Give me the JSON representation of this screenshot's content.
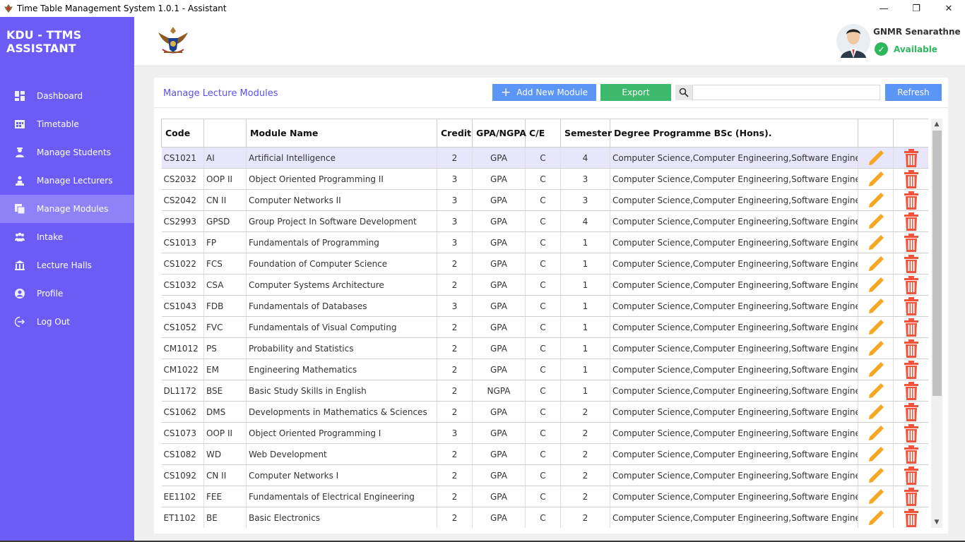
{
  "window": {
    "title": "Time Table Management System 1.0.1 - Assistant",
    "minimize": "—",
    "maximize": "❐",
    "close": "✕"
  },
  "brand": "KDU - TTMS ASSISTANT",
  "sidebar": {
    "items": [
      {
        "label": "Dashboard",
        "icon": "dashboard-icon"
      },
      {
        "label": "Timetable",
        "icon": "timetable-icon"
      },
      {
        "label": "Manage Students",
        "icon": "student-icon"
      },
      {
        "label": "Manage Lecturers",
        "icon": "lecturer-icon"
      },
      {
        "label": "Manage Modules",
        "icon": "modules-icon",
        "active": true
      },
      {
        "label": "Intake",
        "icon": "intake-icon"
      },
      {
        "label": "Lecture Halls",
        "icon": "building-icon"
      },
      {
        "label": "Profile",
        "icon": "profile-icon"
      },
      {
        "label": "Log Out",
        "icon": "logout-icon"
      }
    ]
  },
  "user": {
    "name": "GNMR Senarathne",
    "status": "Available"
  },
  "panel": {
    "title": "Manage Lecture Modules",
    "add_label": "Add New Module",
    "export_label": "Export",
    "refresh_label": "Refresh",
    "search_value": ""
  },
  "table": {
    "headers": [
      "Code",
      "",
      "Module Name",
      "Credit",
      "GPA/NGPA",
      "C/E",
      "Semester",
      "Degree Programme BSc (Hons).",
      "",
      ""
    ],
    "rows": [
      [
        "CS1021",
        "AI",
        "Artificial Intelligence",
        "2",
        "GPA",
        "C",
        "4",
        "Computer Science,Computer Engineering,Software Engineering"
      ],
      [
        "CS2032",
        "OOP II",
        "Object Oriented Programming II",
        "3",
        "GPA",
        "C",
        "3",
        "Computer Science,Computer Engineering,Software Engineering"
      ],
      [
        "CS2042",
        "CN II",
        "Computer Networks II",
        "3",
        "GPA",
        "C",
        "3",
        "Computer Science,Computer Engineering,Software Engineering"
      ],
      [
        "CS2993",
        "GPSD",
        "Group Project In Software Development",
        "3",
        "GPA",
        "C",
        "4",
        "Computer Science,Computer Engineering,Software Engineering"
      ],
      [
        "CS1013",
        "FP",
        "Fundamentals of Programming",
        "3",
        "GPA",
        "C",
        "1",
        "Computer Science,Computer Engineering,Software Engineering"
      ],
      [
        "CS1022",
        "FCS",
        "Foundation of Computer Science",
        "2",
        "GPA",
        "C",
        "1",
        "Computer Science,Computer Engineering,Software Engineering"
      ],
      [
        "CS1032",
        "CSA",
        "Computer Systems Architecture",
        "2",
        "GPA",
        "C",
        "1",
        "Computer Science,Computer Engineering,Software Engineering"
      ],
      [
        "CS1043",
        "FDB",
        "Fundamentals of Databases",
        "3",
        "GPA",
        "C",
        "1",
        "Computer Science,Computer Engineering,Software Engineering"
      ],
      [
        "CS1052",
        "FVC",
        "Fundamentals of Visual Computing",
        "2",
        "GPA",
        "C",
        "1",
        "Computer Science,Computer Engineering,Software Engineering"
      ],
      [
        "CM1012",
        "PS",
        "Probability and Statistics",
        "2",
        "GPA",
        "C",
        "1",
        "Computer Science,Computer Engineering,Software Engineering"
      ],
      [
        "CM1022",
        "EM",
        "Engineering Mathematics",
        "2",
        "GPA",
        "C",
        "1",
        "Computer Science,Computer Engineering,Software Engineering"
      ],
      [
        "DL1172",
        "BSE",
        "Basic Study Skills in English",
        "2",
        "NGPA",
        "C",
        "1",
        "Computer Science,Computer Engineering,Software Engineering"
      ],
      [
        "CS1062",
        "DMS",
        "Developments in Mathematics & Sciences",
        "2",
        "GPA",
        "C",
        "2",
        "Computer Science,Computer Engineering,Software Engineering"
      ],
      [
        "CS1073",
        "OOP II",
        "Object Oriented Programming I",
        "3",
        "GPA",
        "C",
        "2",
        "Computer Science,Computer Engineering,Software Engineering"
      ],
      [
        "CS1082",
        "WD",
        "Web Development",
        "2",
        "GPA",
        "C",
        "2",
        "Computer Science,Computer Engineering,Software Engineering"
      ],
      [
        "CS1092",
        "CN II",
        "Computer Networks I",
        "2",
        "GPA",
        "C",
        "2",
        "Computer Science,Computer Engineering,Software Engineering"
      ],
      [
        "EE1102",
        "FEE",
        "Fundamentals of Electrical Engineering",
        "2",
        "GPA",
        "C",
        "2",
        "Computer Science,Computer Engineering,Software Engineering"
      ],
      [
        "ET1102",
        "BE",
        "Basic Electronics",
        "2",
        "GPA",
        "C",
        "2",
        "Computer Science,Computer Engineering,Software Engineering"
      ]
    ],
    "edit_icon": "pencil-icon",
    "delete_icon": "trash-icon"
  },
  "colors": {
    "sidebar": "#6b5cf6",
    "sidebar_active": "#8e82f9",
    "add_button": "#5b95f5",
    "export_button": "#3cb96a",
    "edit_icon": "#f5a623",
    "delete_icon": "#f0543c",
    "available": "#2eb85c"
  }
}
